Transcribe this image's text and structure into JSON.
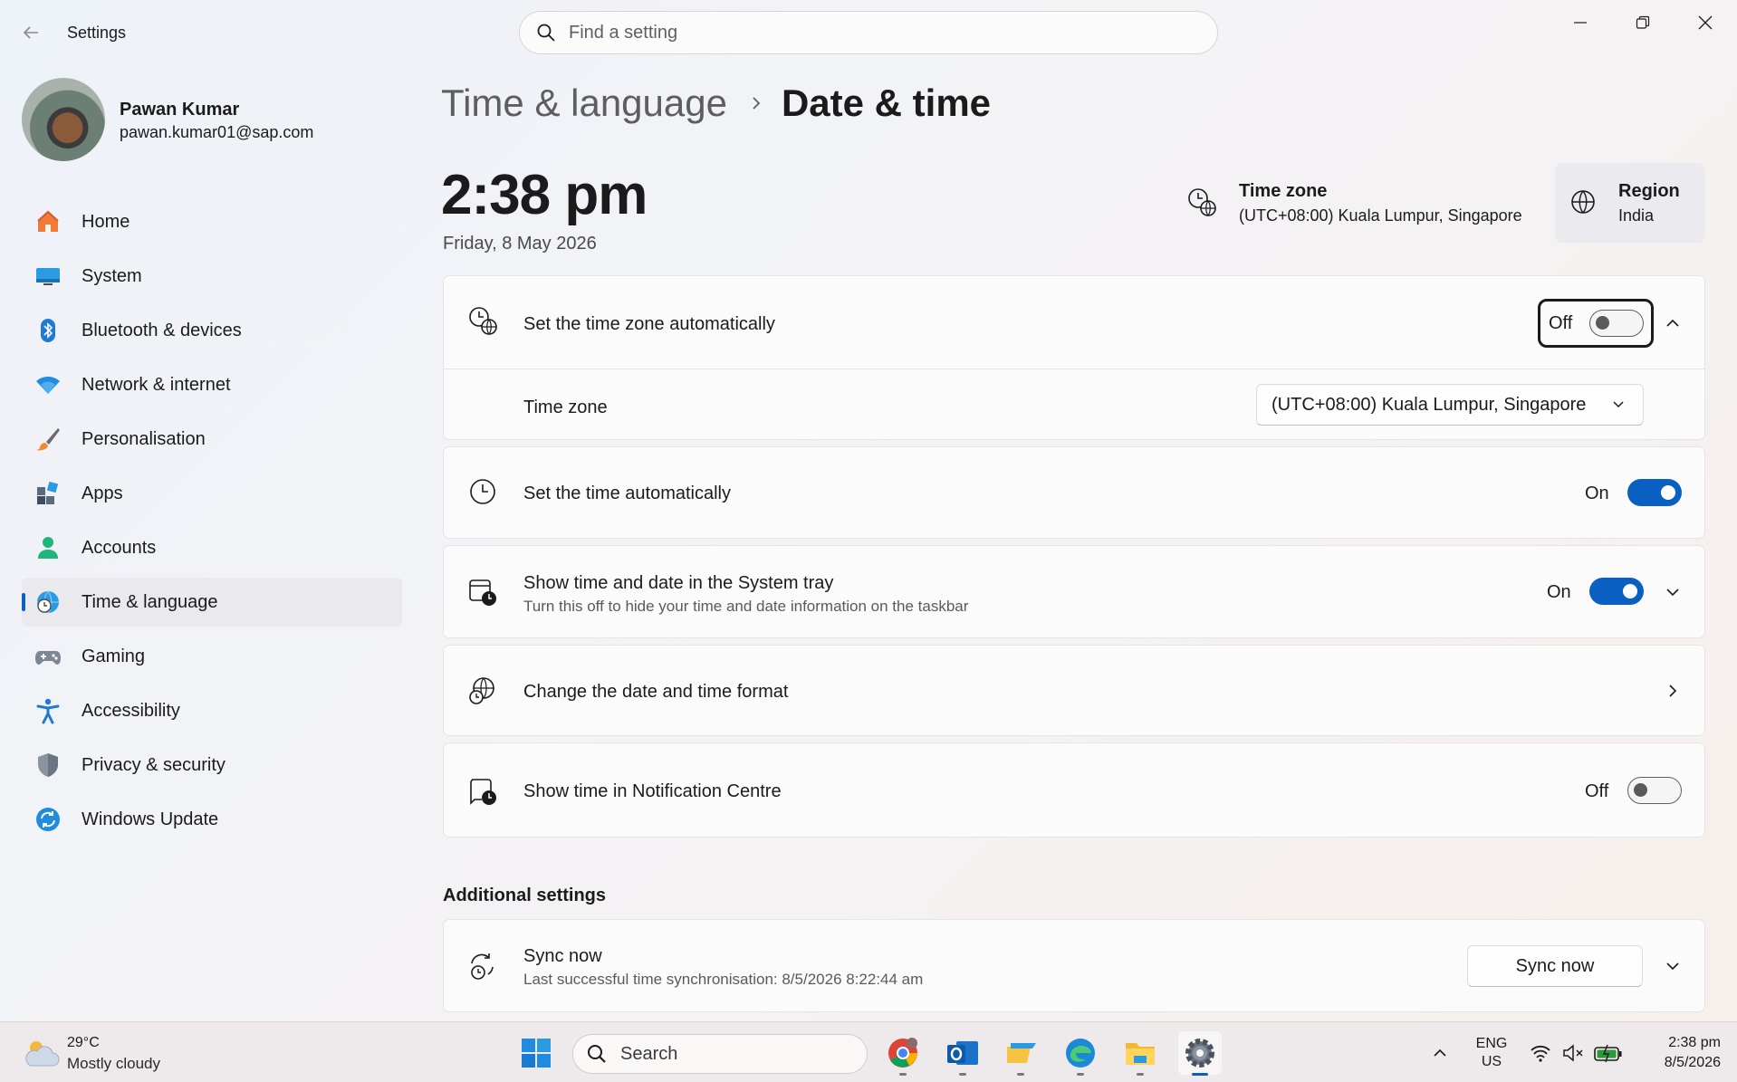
{
  "window": {
    "app_title": "Settings",
    "search_placeholder": "Find a setting"
  },
  "profile": {
    "name": "Pawan Kumar",
    "email": "pawan.kumar01@sap.com"
  },
  "sidebar": {
    "items": [
      {
        "label": "Home",
        "icon": "home-icon",
        "active": false
      },
      {
        "label": "System",
        "icon": "system-icon",
        "active": false
      },
      {
        "label": "Bluetooth & devices",
        "icon": "bluetooth-icon",
        "active": false
      },
      {
        "label": "Network & internet",
        "icon": "wifi-icon",
        "active": false
      },
      {
        "label": "Personalisation",
        "icon": "brush-icon",
        "active": false
      },
      {
        "label": "Apps",
        "icon": "apps-icon",
        "active": false
      },
      {
        "label": "Accounts",
        "icon": "account-icon",
        "active": false
      },
      {
        "label": "Time & language",
        "icon": "globe-clock-icon",
        "active": true
      },
      {
        "label": "Gaming",
        "icon": "gamepad-icon",
        "active": false
      },
      {
        "label": "Accessibility",
        "icon": "accessibility-icon",
        "active": false
      },
      {
        "label": "Privacy & security",
        "icon": "shield-icon",
        "active": false
      },
      {
        "label": "Windows Update",
        "icon": "update-icon",
        "active": false
      }
    ]
  },
  "breadcrumb": {
    "parent": "Time & language",
    "current": "Date & time"
  },
  "clock": {
    "time": "2:38 pm",
    "date": "Friday, 8 May 2026"
  },
  "timezone_info": {
    "title": "Time zone",
    "value": "(UTC+08:00) Kuala Lumpur, Singapore"
  },
  "region": {
    "title": "Region",
    "value": "India"
  },
  "settings": {
    "auto_timezone": {
      "title": "Set the time zone automatically",
      "state_label": "Off",
      "on": false
    },
    "time_zone": {
      "title": "Time zone",
      "selected": "(UTC+08:00) Kuala Lumpur, Singapore"
    },
    "auto_time": {
      "title": "Set the time automatically",
      "state_label": "On",
      "on": true
    },
    "system_tray": {
      "title": "Show time and date in the System tray",
      "subtitle": "Turn this off to hide your time and date information on the taskbar",
      "state_label": "On",
      "on": true
    },
    "format": {
      "title": "Change the date and time format"
    },
    "notification_centre": {
      "title": "Show time in Notification Centre",
      "state_label": "Off",
      "on": false
    }
  },
  "additional": {
    "heading": "Additional settings",
    "sync": {
      "title": "Sync now",
      "subtitle": "Last successful time synchronisation: 8/5/2026 8:22:44 am",
      "button": "Sync now"
    }
  },
  "taskbar": {
    "weather": {
      "temp": "29°C",
      "condition": "Mostly cloudy"
    },
    "search": "Search",
    "apps": [
      "start-icon",
      "chrome-icon",
      "outlook-icon",
      "sticky-notes-icon",
      "edge-icon",
      "file-explorer-icon",
      "settings-icon"
    ],
    "language": {
      "line1": "ENG",
      "line2": "US"
    },
    "clock": {
      "time": "2:38 pm",
      "date": "8/5/2026"
    }
  },
  "colors": {
    "accent": "#0a5fc2",
    "toggle_on": "#0a5fc2"
  }
}
